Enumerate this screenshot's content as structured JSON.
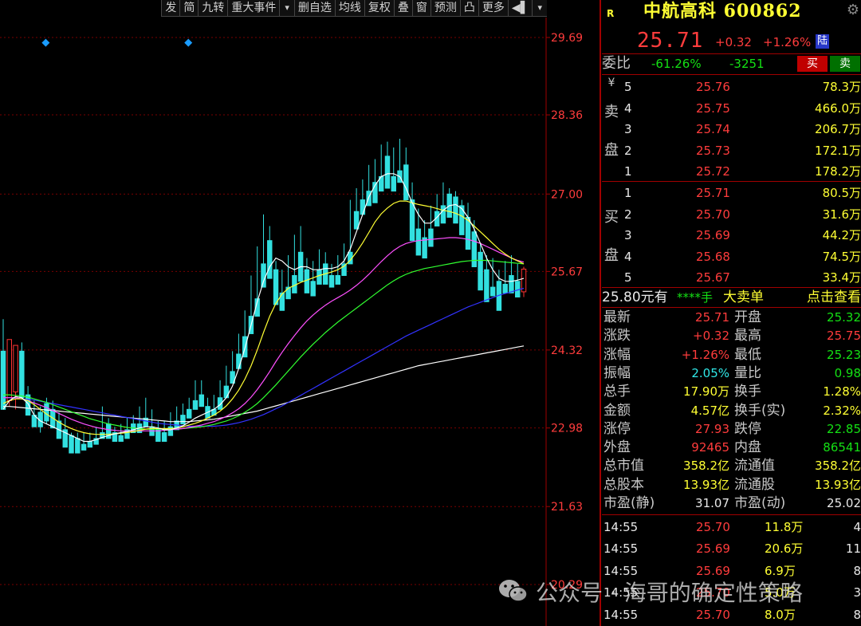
{
  "toolbar": {
    "items": [
      "发",
      "简",
      "九转",
      "重大事件",
      "▾",
      "删自选",
      "均线",
      "复权",
      "叠",
      "窗",
      "预测",
      "凸",
      "更多",
      "◀▌",
      "▾"
    ]
  },
  "chart_data": {
    "type": "candlestick",
    "y_axis_labels": [
      "29.69",
      "28.36",
      "27.00",
      "25.67",
      "24.32",
      "22.98",
      "21.63",
      "20.29"
    ],
    "ylim": [
      20.29,
      29.69
    ],
    "grid": "horizontal dotted red",
    "colors": {
      "up": "#ff3232",
      "down": "#32e0e0",
      "ma5": "#ffffff",
      "ma10": "#ffff33",
      "ma20": "#ff50ff",
      "ma30": "#30ff30",
      "ma60": "#3232ff",
      "ma120": "#ffffff"
    },
    "candles": [
      [
        24.3,
        24.85,
        23.4,
        23.3
      ],
      [
        23.45,
        24.2,
        23.35,
        24.5
      ],
      [
        23.6,
        24.35,
        23.3,
        24.4
      ],
      [
        24.3,
        24.45,
        23.6,
        23.5
      ],
      [
        23.55,
        23.7,
        23.25,
        23.2
      ],
      [
        23.2,
        23.45,
        23.1,
        23.0
      ],
      [
        23.25,
        23.35,
        22.9,
        23.0
      ],
      [
        23.4,
        23.5,
        23.05,
        23.1
      ],
      [
        23.3,
        23.45,
        23.0,
        22.98
      ],
      [
        23.1,
        23.25,
        22.85,
        22.8
      ],
      [
        22.95,
        23.15,
        22.7,
        22.65
      ],
      [
        22.85,
        22.9,
        22.65,
        22.55
      ],
      [
        22.8,
        22.9,
        22.6,
        22.55
      ],
      [
        22.7,
        22.9,
        22.65,
        22.6
      ],
      [
        22.75,
        22.9,
        22.7,
        22.65
      ],
      [
        22.8,
        23.0,
        22.75,
        22.7
      ],
      [
        22.9,
        23.35,
        22.85,
        22.8
      ],
      [
        23.05,
        23.15,
        22.85,
        22.8
      ],
      [
        22.9,
        23.0,
        22.8,
        22.75
      ],
      [
        22.85,
        23.05,
        22.8,
        22.75
      ],
      [
        22.95,
        23.15,
        22.85,
        22.8
      ],
      [
        23.05,
        23.2,
        22.95,
        22.9
      ],
      [
        23.05,
        23.35,
        22.95,
        22.9
      ],
      [
        23.15,
        23.5,
        23.05,
        23.0
      ],
      [
        23.0,
        23.3,
        22.9,
        22.85
      ],
      [
        22.95,
        23.1,
        22.85,
        22.75
      ],
      [
        22.9,
        23.1,
        22.8,
        22.75
      ],
      [
        23.0,
        23.25,
        22.9,
        22.85
      ],
      [
        23.1,
        23.35,
        23.0,
        22.95
      ],
      [
        23.2,
        23.4,
        23.1,
        23.05
      ],
      [
        23.3,
        23.5,
        23.2,
        23.15
      ],
      [
        23.45,
        23.8,
        23.35,
        23.3
      ],
      [
        23.55,
        23.8,
        23.4,
        23.35
      ],
      [
        23.35,
        23.5,
        23.2,
        23.15
      ],
      [
        23.3,
        23.55,
        23.25,
        23.2
      ],
      [
        23.5,
        23.8,
        23.4,
        23.3
      ],
      [
        23.7,
        24.05,
        23.6,
        23.5
      ],
      [
        23.95,
        24.3,
        23.85,
        23.75
      ],
      [
        24.25,
        24.6,
        24.1,
        24.0
      ],
      [
        24.55,
        25.0,
        24.35,
        24.2
      ],
      [
        24.9,
        25.6,
        24.8,
        24.6
      ],
      [
        25.2,
        26.1,
        25.05,
        24.9
      ],
      [
        25.8,
        26.65,
        25.6,
        25.4
      ],
      [
        26.2,
        26.45,
        25.7,
        25.55
      ],
      [
        25.7,
        25.85,
        25.25,
        25.1
      ],
      [
        25.3,
        25.7,
        25.15,
        25.0
      ],
      [
        25.4,
        25.95,
        25.3,
        25.2
      ],
      [
        25.6,
        26.3,
        25.45,
        25.3
      ],
      [
        26.0,
        26.45,
        25.6,
        25.5
      ],
      [
        25.7,
        25.9,
        25.4,
        25.3
      ],
      [
        25.5,
        25.85,
        25.35,
        25.25
      ],
      [
        25.7,
        26.05,
        25.55,
        25.45
      ],
      [
        25.8,
        26.0,
        25.55,
        25.45
      ],
      [
        25.6,
        25.8,
        25.45,
        25.4
      ],
      [
        25.6,
        25.95,
        25.5,
        25.45
      ],
      [
        25.8,
        26.15,
        25.65,
        25.6
      ],
      [
        26.0,
        26.9,
        25.9,
        25.8
      ],
      [
        26.7,
        27.1,
        26.5,
        26.4
      ],
      [
        26.9,
        27.25,
        26.75,
        26.65
      ],
      [
        27.05,
        27.5,
        26.9,
        26.8
      ],
      [
        27.2,
        27.6,
        26.95,
        26.85
      ],
      [
        27.3,
        27.85,
        27.2,
        27.05
      ],
      [
        27.65,
        27.9,
        27.2,
        27.1
      ],
      [
        27.3,
        27.8,
        27.15,
        27.05
      ],
      [
        27.4,
        27.95,
        27.3,
        27.2
      ],
      [
        27.5,
        27.8,
        27.0,
        26.9
      ],
      [
        26.9,
        27.2,
        26.3,
        26.2
      ],
      [
        26.4,
        26.75,
        26.05,
        25.95
      ],
      [
        26.25,
        26.55,
        26.0,
        25.9
      ],
      [
        26.4,
        26.8,
        26.25,
        26.1
      ],
      [
        26.7,
        27.0,
        26.55,
        26.45
      ],
      [
        26.8,
        27.2,
        26.6,
        26.5
      ],
      [
        27.0,
        27.1,
        26.7,
        26.6
      ],
      [
        26.95,
        27.05,
        26.6,
        26.5
      ],
      [
        26.8,
        26.9,
        26.4,
        26.3
      ],
      [
        26.6,
        26.85,
        26.15,
        26.05
      ],
      [
        26.35,
        26.55,
        25.85,
        25.75
      ],
      [
        26.0,
        26.15,
        25.45,
        25.35
      ],
      [
        25.7,
        25.95,
        25.25,
        25.15
      ],
      [
        25.4,
        25.9,
        25.3,
        25.25
      ],
      [
        25.5,
        25.7,
        25.1,
        25.0
      ],
      [
        25.45,
        25.85,
        25.4,
        25.3
      ],
      [
        25.6,
        25.95,
        25.4,
        25.3
      ],
      [
        25.5,
        25.8,
        25.25,
        25.23
      ],
      [
        25.32,
        25.75,
        25.23,
        25.71
      ]
    ],
    "ma_lines": {
      "ma5": [
        23.3,
        23.45,
        23.52,
        23.5,
        23.4,
        23.2,
        23.1,
        23.05,
        23.0,
        22.95,
        22.9,
        22.85,
        22.8,
        22.75,
        22.75,
        22.78,
        22.82,
        22.85,
        22.88,
        22.9,
        22.92,
        22.95,
        22.98,
        23.0,
        23.0,
        22.98,
        22.95,
        22.95,
        22.98,
        23.02,
        23.08,
        23.15,
        23.2,
        23.25,
        23.3,
        23.38,
        23.5,
        23.7,
        24.0,
        24.35,
        24.75,
        25.15,
        25.5,
        25.75,
        25.9,
        25.85,
        25.75,
        25.7,
        25.75,
        25.75,
        25.7,
        25.7,
        25.72,
        25.72,
        25.75,
        25.85,
        26.05,
        26.35,
        26.65,
        26.95,
        27.15,
        27.3,
        27.35,
        27.35,
        27.3,
        27.1,
        26.85,
        26.65,
        26.5,
        26.5,
        26.6,
        26.72,
        26.8,
        26.82,
        26.75,
        26.6,
        26.4,
        26.15,
        25.9,
        25.7,
        25.55,
        25.5,
        25.5,
        25.52,
        25.55
      ],
      "ma10": [
        23.4,
        23.45,
        23.48,
        23.48,
        23.45,
        23.38,
        23.3,
        23.22,
        23.15,
        23.08,
        23.02,
        22.97,
        22.93,
        22.9,
        22.88,
        22.87,
        22.87,
        22.87,
        22.88,
        22.89,
        22.9,
        22.92,
        22.94,
        22.96,
        22.97,
        22.97,
        22.97,
        22.97,
        22.98,
        23.0,
        23.03,
        23.06,
        23.1,
        23.15,
        23.2,
        23.27,
        23.36,
        23.48,
        23.63,
        23.82,
        24.05,
        24.32,
        24.62,
        24.9,
        25.12,
        25.28,
        25.38,
        25.43,
        25.48,
        25.52,
        25.56,
        25.6,
        25.63,
        25.66,
        25.7,
        25.76,
        25.86,
        26.0,
        26.16,
        26.34,
        26.52,
        26.66,
        26.76,
        26.84,
        26.88,
        26.88,
        26.85,
        26.82,
        26.8,
        26.78,
        26.75,
        26.72,
        26.7,
        26.67,
        26.62,
        26.55,
        26.45,
        26.35,
        26.25,
        26.15,
        26.05,
        25.97,
        25.9,
        25.85,
        25.8
      ],
      "ma20": [
        23.5,
        23.5,
        23.5,
        23.48,
        23.45,
        23.41,
        23.37,
        23.33,
        23.28,
        23.23,
        23.18,
        23.13,
        23.09,
        23.05,
        23.02,
        22.99,
        22.97,
        22.95,
        22.94,
        22.93,
        22.93,
        22.93,
        22.93,
        22.93,
        22.93,
        22.93,
        22.94,
        22.95,
        22.96,
        22.97,
        22.99,
        23.01,
        23.03,
        23.06,
        23.09,
        23.13,
        23.18,
        23.24,
        23.31,
        23.4,
        23.51,
        23.64,
        23.79,
        23.95,
        24.12,
        24.28,
        24.43,
        24.57,
        24.7,
        24.82,
        24.92,
        25.01,
        25.09,
        25.16,
        25.22,
        25.28,
        25.35,
        25.43,
        25.52,
        25.62,
        25.73,
        25.84,
        25.94,
        26.03,
        26.1,
        26.15,
        26.18,
        26.2,
        26.21,
        26.22,
        26.23,
        26.24,
        26.25,
        26.25,
        26.24,
        26.22,
        26.19,
        26.15,
        26.1,
        26.05,
        26.0,
        25.95,
        25.9,
        25.86,
        25.83
      ],
      "ma30": [
        23.55,
        23.55,
        23.54,
        23.53,
        23.51,
        23.48,
        23.45,
        23.42,
        23.38,
        23.34,
        23.3,
        23.26,
        23.22,
        23.18,
        23.14,
        23.11,
        23.08,
        23.05,
        23.03,
        23.01,
        22.99,
        22.98,
        22.97,
        22.96,
        22.96,
        22.96,
        22.96,
        22.96,
        22.96,
        22.97,
        22.98,
        22.99,
        23.0,
        23.02,
        23.04,
        23.07,
        23.1,
        23.14,
        23.19,
        23.25,
        23.32,
        23.4,
        23.5,
        23.61,
        23.72,
        23.84,
        23.96,
        24.08,
        24.2,
        24.31,
        24.42,
        24.52,
        24.62,
        24.71,
        24.8,
        24.88,
        24.96,
        25.04,
        25.12,
        25.2,
        25.28,
        25.36,
        25.44,
        25.51,
        25.57,
        25.62,
        25.66,
        25.69,
        25.72,
        25.74,
        25.76,
        25.78,
        25.8,
        25.82,
        25.84,
        25.85,
        25.86,
        25.86,
        25.86,
        25.85,
        25.84,
        25.83,
        25.82,
        25.81,
        25.8
      ],
      "ma60": [
        23.5,
        23.5,
        23.49,
        23.48,
        23.47,
        23.46,
        23.44,
        23.42,
        23.4,
        23.38,
        23.36,
        23.34,
        23.32,
        23.3,
        23.28,
        23.26,
        23.24,
        23.22,
        23.2,
        23.18,
        23.16,
        23.14,
        23.12,
        23.1,
        23.08,
        23.06,
        23.05,
        23.04,
        23.03,
        23.02,
        23.01,
        23.01,
        23.01,
        23.01,
        23.01,
        23.02,
        23.03,
        23.05,
        23.07,
        23.1,
        23.13,
        23.17,
        23.21,
        23.26,
        23.31,
        23.36,
        23.42,
        23.48,
        23.54,
        23.6,
        23.66,
        23.72,
        23.78,
        23.84,
        23.9,
        23.96,
        24.02,
        24.08,
        24.14,
        24.2,
        24.26,
        24.32,
        24.38,
        24.44,
        24.5,
        24.56,
        24.61,
        24.66,
        24.71,
        24.76,
        24.81,
        24.86,
        24.91,
        24.96,
        25.01,
        25.06,
        25.1,
        25.14,
        25.18,
        25.22,
        25.26,
        25.29,
        25.32,
        25.35,
        25.38
      ],
      "ma120": [
        23.35,
        23.35,
        23.34,
        23.33,
        23.32,
        23.31,
        23.3,
        23.29,
        23.28,
        23.27,
        23.26,
        23.25,
        23.24,
        23.23,
        23.22,
        23.21,
        23.2,
        23.19,
        23.18,
        23.17,
        23.16,
        23.15,
        23.14,
        23.13,
        23.12,
        23.11,
        23.1,
        23.09,
        23.09,
        23.09,
        23.09,
        23.1,
        23.11,
        23.12,
        23.13,
        23.15,
        23.17,
        23.19,
        23.21,
        23.23,
        23.25,
        23.27,
        23.3,
        23.33,
        23.36,
        23.39,
        23.42,
        23.45,
        23.48,
        23.51,
        23.54,
        23.57,
        23.6,
        23.63,
        23.66,
        23.69,
        23.72,
        23.75,
        23.78,
        23.81,
        23.84,
        23.87,
        23.9,
        23.93,
        23.96,
        23.99,
        24.02,
        24.05,
        24.07,
        24.09,
        24.11,
        24.13,
        24.15,
        24.17,
        24.19,
        24.21,
        24.23,
        24.25,
        24.27,
        24.29,
        24.31,
        24.33,
        24.35,
        24.37,
        24.39
      ]
    },
    "markers": [
      {
        "x_index": 7,
        "symbol": "◆",
        "color": "#1a9cff"
      },
      {
        "x_index": 30,
        "symbol": "◆",
        "color": "#1a9cff"
      }
    ]
  },
  "quote": {
    "badge": "R",
    "name": "中航高科 600862",
    "price": "25.71",
    "change": "+0.32",
    "change_pct": "+1.26%",
    "market": "陆",
    "weibi_label": "委比",
    "weibi_pct": "-61.26%",
    "weibi_diff": "-3251",
    "buy_btn": "买",
    "sell_btn": "卖",
    "ask_label_top": "¥",
    "ask_label_mid": "卖",
    "ask_label_bot": "盘",
    "bid_label_top": "买",
    "bid_label_bot": "盘",
    "asks": [
      {
        "level": "5",
        "price": "25.76",
        "vol": "78.3万"
      },
      {
        "level": "4",
        "price": "25.75",
        "vol": "466.0万"
      },
      {
        "level": "3",
        "price": "25.74",
        "vol": "206.7万"
      },
      {
        "level": "2",
        "price": "25.73",
        "vol": "172.1万"
      },
      {
        "level": "1",
        "price": "25.72",
        "vol": "178.2万"
      }
    ],
    "bids": [
      {
        "level": "1",
        "price": "25.71",
        "vol": "80.5万"
      },
      {
        "level": "2",
        "price": "25.70",
        "vol": "31.6万"
      },
      {
        "level": "3",
        "price": "25.69",
        "vol": "44.2万"
      },
      {
        "level": "4",
        "price": "25.68",
        "vol": "74.5万"
      },
      {
        "level": "5",
        "price": "25.67",
        "vol": "33.4万"
      }
    ],
    "big_order": {
      "price": "25.80元有",
      "qty": "****手",
      "label": "大卖单",
      "link": "点击查看"
    },
    "stats": [
      {
        "l1": "最新",
        "v1": "25.71",
        "c1": "red",
        "l2": "开盘",
        "v2": "25.32",
        "c2": "green"
      },
      {
        "l1": "涨跌",
        "v1": "+0.32",
        "c1": "red",
        "l2": "最高",
        "v2": "25.75",
        "c2": "red"
      },
      {
        "l1": "涨幅",
        "v1": "+1.26%",
        "c1": "red",
        "l2": "最低",
        "v2": "25.23",
        "c2": "green"
      },
      {
        "l1": "振幅",
        "v1": "2.05%",
        "c1": "cyan",
        "l2": "量比",
        "v2": "0.98",
        "c2": "green"
      },
      {
        "l1": "总手",
        "v1": "17.90万",
        "c1": "yellow",
        "l2": "换手",
        "v2": "1.28%",
        "c2": "yellow"
      },
      {
        "l1": "金额",
        "v1": "4.57亿",
        "c1": "yellow",
        "l2": "换手(实)",
        "v2": "2.32%",
        "c2": "yellow"
      },
      {
        "l1": "涨停",
        "v1": "27.93",
        "c1": "red",
        "l2": "跌停",
        "v2": "22.85",
        "c2": "green"
      },
      {
        "l1": "外盘",
        "v1": "92465",
        "c1": "red",
        "l2": "内盘",
        "v2": "86541",
        "c2": "green"
      },
      {
        "l1": "总市值",
        "v1": "358.2亿",
        "c1": "yellow",
        "l2": "流通值",
        "v2": "358.2亿",
        "c2": "yellow"
      },
      {
        "l1": "总股本",
        "v1": "13.93亿",
        "c1": "yellow",
        "l2": "流通股",
        "v2": "13.93亿",
        "c2": "yellow"
      },
      {
        "l1": "市盈(静)",
        "v1": "31.07",
        "c1": "white",
        "l2": "市盈(动)",
        "v2": "25.02",
        "c2": "white"
      }
    ],
    "ticks": [
      {
        "time": "14:55",
        "price": "25.70",
        "vol": "11.8万",
        "extra": "4"
      },
      {
        "time": "14:55",
        "price": "25.69",
        "vol": "20.6万",
        "extra": "11"
      },
      {
        "time": "14:55",
        "price": "25.69",
        "vol": "6.9万",
        "extra": "8"
      },
      {
        "time": "14:55",
        "price": "25.70",
        "vol": "5.0万",
        "extra": "3"
      },
      {
        "time": "14:55",
        "price": "25.70",
        "vol": "8.0万",
        "extra": "8"
      }
    ]
  },
  "watermark": {
    "text": "公众号 · 海哥的确定性策略"
  }
}
